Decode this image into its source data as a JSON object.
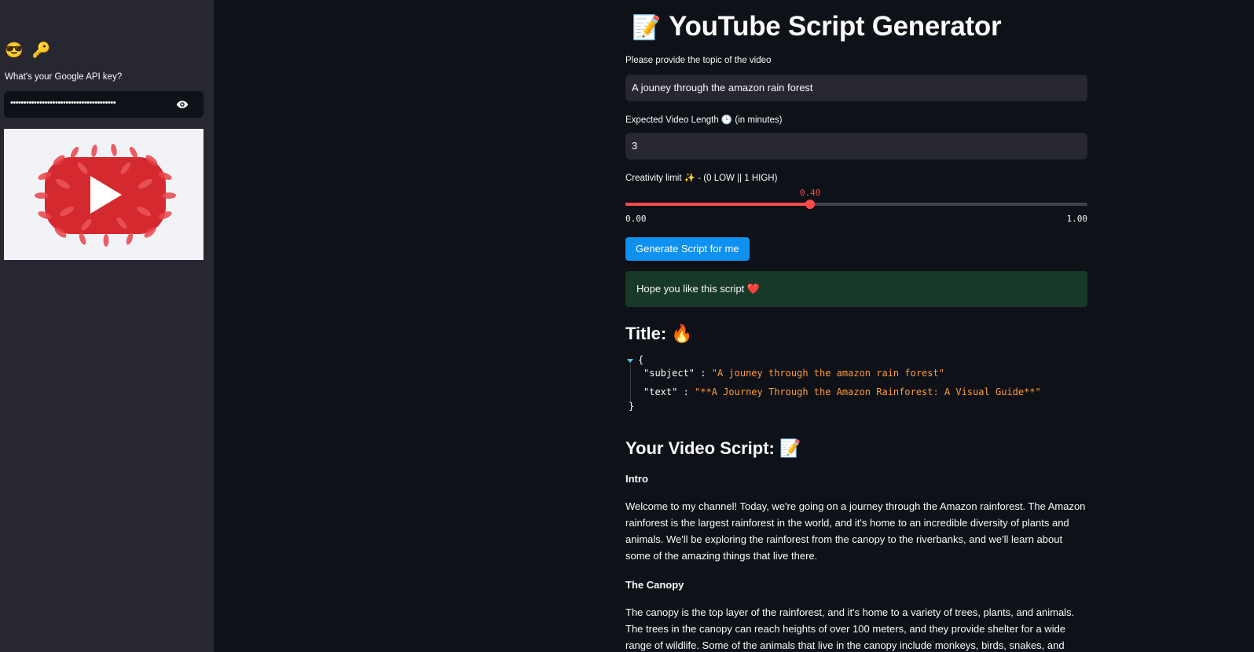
{
  "sidebar": {
    "emojis": "😎 🔑",
    "api_key_label": "What's your Google API key?",
    "api_key_value": "••••••••••••••••••••••••••••••••••••••••",
    "image_alt": "YouTube logo made of red leaves"
  },
  "main": {
    "title_emoji": "📝",
    "title": "YouTube Script Generator",
    "topic_label": "Please provide the topic of the video",
    "topic_value": "A jouney through the amazon rain forest",
    "length_label": "Expected Video Length 🕒 (in minutes)",
    "length_value": "3",
    "creativity_label": "Creativity limit ✨ - (0 LOW || 1 HIGH)",
    "slider": {
      "value": 0.4,
      "value_text": "0.40",
      "min_text": "0.00",
      "max_text": "1.00",
      "min": 0,
      "max": 1
    },
    "generate_button": "Generate Script for me",
    "success_message": "Hope you like this script ❤️",
    "title_heading": "Title: 🔥",
    "json": {
      "open_brace": "{",
      "close_brace": "}",
      "subject_key": "\"subject\"",
      "subject_value": "\"A jouney through the amazon rain forest\"",
      "text_key": "\"text\"",
      "text_value": "\"**A Journey Through the Amazon Rainforest: A Visual Guide**\"",
      "separator": ":"
    },
    "script_heading": "Your Video Script: 📝",
    "script": {
      "intro_heading": "Intro",
      "intro_text": "Welcome to my channel! Today, we're going on a journey through the Amazon rainforest. The Amazon rainforest is the largest rainforest in the world, and it's home to an incredible diversity of plants and animals. We'll be exploring the rainforest from the canopy to the riverbanks, and we'll learn about some of the amazing things that live there.",
      "canopy_heading": "The Canopy",
      "canopy_text": "The canopy is the top layer of the rainforest, and it's home to a variety of trees, plants, and animals. The trees in the canopy can reach heights of over 100 meters, and they provide shelter for a wide range of wildlife. Some of the animals that live in the canopy include monkeys, birds, snakes, and insects."
    }
  },
  "colors": {
    "background": "#0e1117",
    "sidebar": "#262730",
    "accent": "#ff4b4b",
    "button": "#0e91f0",
    "success_bg": "#173928",
    "json_string": "#ff9a3c"
  }
}
